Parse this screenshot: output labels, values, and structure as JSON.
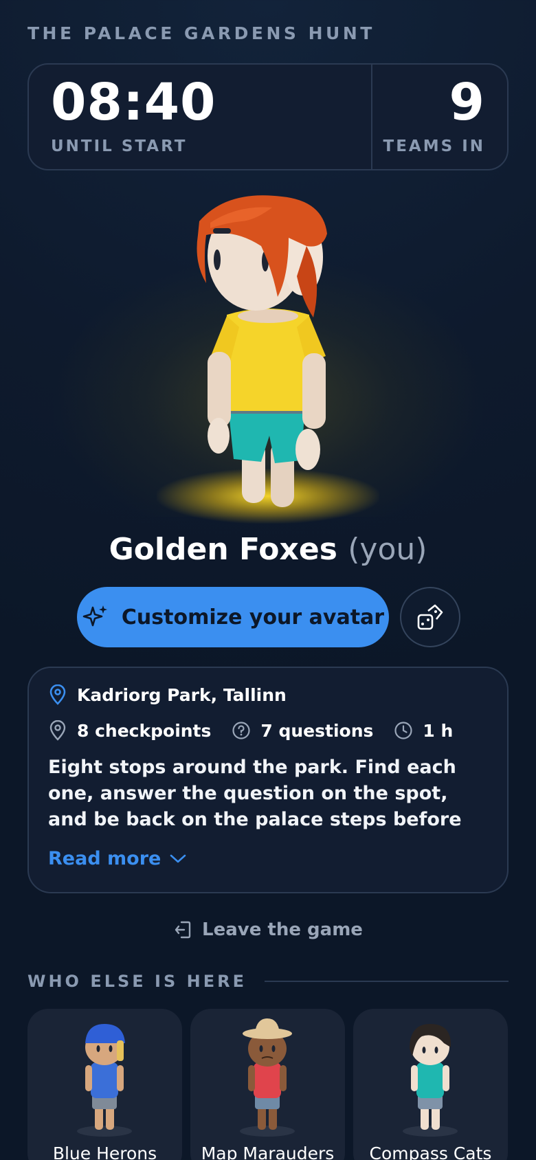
{
  "hunt": {
    "title": "THE PALACE GARDENS HUNT"
  },
  "countdown": {
    "value": "08:40",
    "label": "UNTIL START"
  },
  "teams_in": {
    "value": "9",
    "label": "TEAMS IN"
  },
  "player": {
    "team_name": "Golden Foxes",
    "you_tag": "(you)"
  },
  "actions": {
    "customize_label": "Customize your avatar",
    "customize_icon": "sparkles-icon",
    "randomize_icon": "dice-icon"
  },
  "details": {
    "location": "Kadriorg Park, Tallinn",
    "checkpoints": "8 checkpoints",
    "questions": "7 questions",
    "duration": "1 h",
    "description": "Eight stops around the park. Find each one, answer the question on the spot, and be back on the palace steps before the clock runs out. …",
    "read_more": "Read more"
  },
  "leave": {
    "label": "Leave the game"
  },
  "others": {
    "heading": "WHO ELSE IS HERE",
    "teams": [
      {
        "name": "Blue Herons"
      },
      {
        "name": "Map Marauders"
      },
      {
        "name": "Compass Cats"
      }
    ]
  },
  "colors": {
    "accent": "#3b8ff0",
    "background": "#0e1a2d",
    "card": "#121d31",
    "muted": "#8a9ab1",
    "spotlight": "#f2d21e"
  }
}
